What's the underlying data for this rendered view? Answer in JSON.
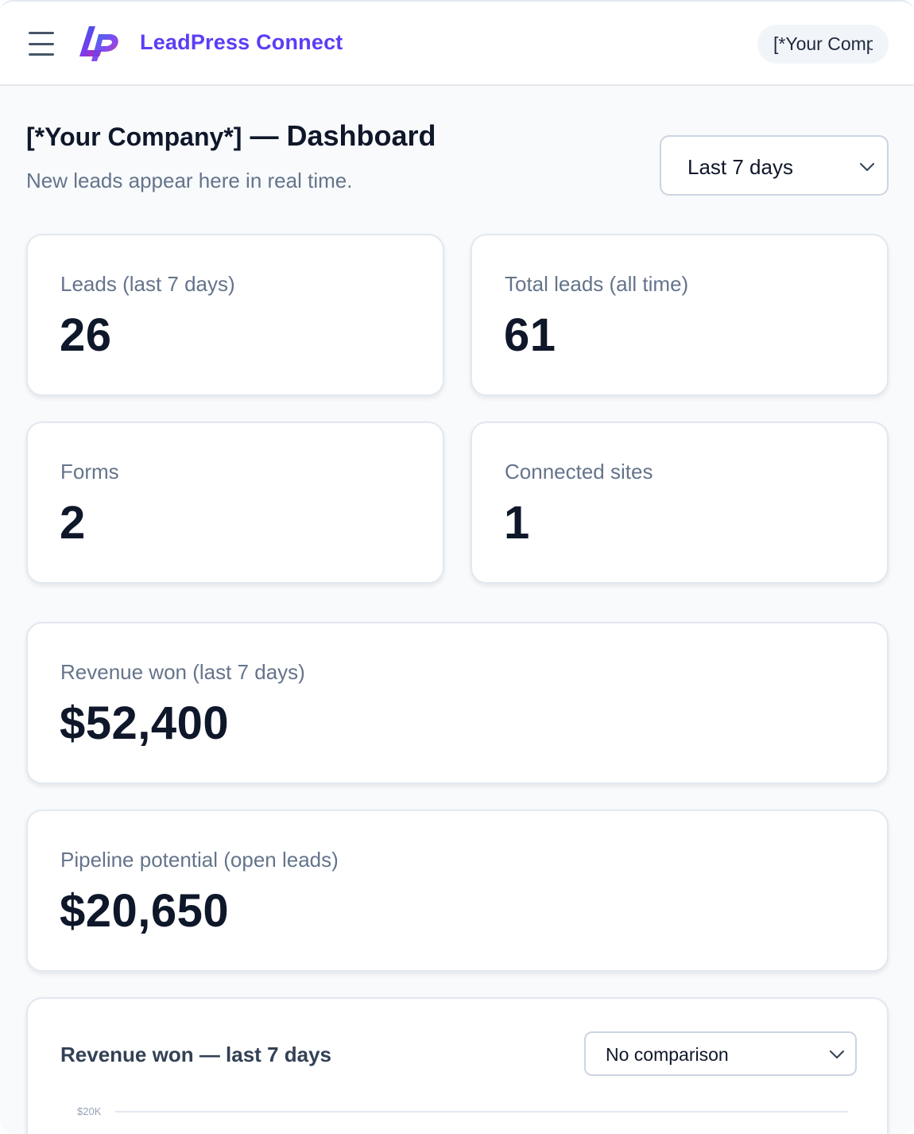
{
  "header": {
    "brand": "LeadPress Connect",
    "company_chip": "[*Your Company*]",
    "icons": {
      "menu": "hamburger-menu-icon",
      "logo": "leadpress-logo"
    },
    "colors": {
      "brand": "#5b3df5",
      "logo_gradient": [
        "#2563eb",
        "#7c3aed",
        "#db2777"
      ]
    }
  },
  "page": {
    "title_company": "[*Your Company*]",
    "title_suffix": "— Dashboard",
    "subtitle": "New leads appear here in real time.",
    "range_select": {
      "selected": "Last 7 days",
      "icon": "chevron-down-icon"
    }
  },
  "stats": {
    "leads_7d": {
      "label": "Leads (last 7 days)",
      "value": "26"
    },
    "total_leads": {
      "label": "Total leads (all time)",
      "value": "61"
    },
    "forms": {
      "label": "Forms",
      "value": "2"
    },
    "connected_sites": {
      "label": "Connected sites",
      "value": "1"
    },
    "revenue_won": {
      "label": "Revenue won (last 7 days)",
      "value": "$52,400"
    },
    "pipeline": {
      "label": "Pipeline potential (open leads)",
      "value": "$20,650"
    }
  },
  "chart": {
    "title": "Revenue won — last 7 days",
    "compare_select": {
      "selected": "No comparison",
      "icon": "chevron-down-icon"
    }
  },
  "chart_data": {
    "type": "bar",
    "title": "Revenue won — last 7 days",
    "y_ticks": [
      "$20K"
    ],
    "grid": true
  }
}
